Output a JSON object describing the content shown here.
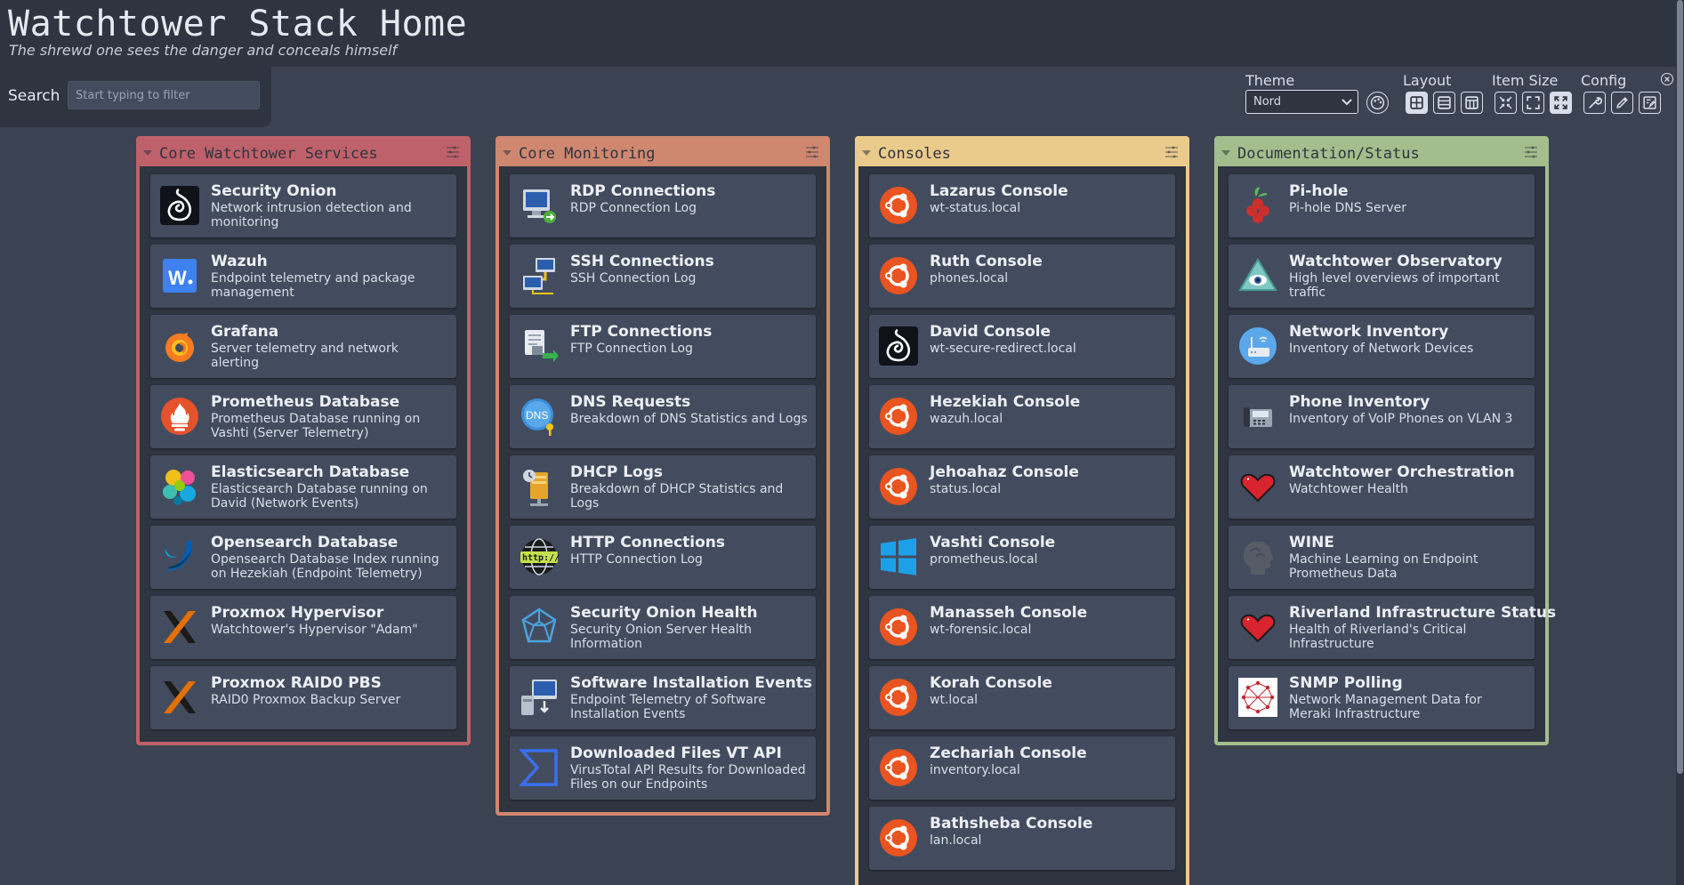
{
  "header": {
    "title": "Watchtower Stack Home",
    "subtitle": "The shrewd one sees the danger and conceals himself"
  },
  "search": {
    "label": "Search",
    "placeholder": "Start typing to filter"
  },
  "settings": {
    "theme_label": "Theme",
    "theme_value": "Nord",
    "layout_label": "Layout",
    "item_size_label": "Item Size",
    "config_label": "Config"
  },
  "colors": {
    "background": "#3b4252",
    "panel": "#2e3440",
    "item": "#434c5e",
    "red": "#bf616a",
    "orange": "#d08770",
    "yellow": "#ebcb8b",
    "green": "#a3be8c"
  },
  "sections": {
    "core": {
      "title": "Core Watchtower Services",
      "items": [
        {
          "name": "Security Onion",
          "desc": "Network intrusion detection and monitoring",
          "icon": "security-onion-icon"
        },
        {
          "name": "Wazuh",
          "desc": "Endpoint telemetry and package management",
          "icon": "wazuh-icon"
        },
        {
          "name": "Grafana",
          "desc": "Server telemetry and network alerting",
          "icon": "grafana-icon"
        },
        {
          "name": "Prometheus Database",
          "desc": "Prometheus Database running on Vashti (Server Telemetry)",
          "icon": "prometheus-icon"
        },
        {
          "name": "Elasticsearch Database",
          "desc": "Elasticsearch Database running on David (Network Events)",
          "icon": "elasticsearch-icon"
        },
        {
          "name": "Opensearch Database",
          "desc": "Opensearch Database Index running on Hezekiah (Endpoint Telemetry)",
          "icon": "opensearch-icon"
        },
        {
          "name": "Proxmox Hypervisor",
          "desc": "Watchtower's Hypervisor \"Adam\"",
          "icon": "proxmox-icon"
        },
        {
          "name": "Proxmox RAID0 PBS",
          "desc": "RAID0 Proxmox Backup Server",
          "icon": "proxmox-icon"
        }
      ]
    },
    "monitoring": {
      "title": "Core Monitoring",
      "items": [
        {
          "name": "RDP Connections",
          "desc": "RDP Connection Log",
          "icon": "rdp-icon"
        },
        {
          "name": "SSH Connections",
          "desc": "SSH Connection Log",
          "icon": "ssh-network-icon"
        },
        {
          "name": "FTP Connections",
          "desc": "FTP Connection Log",
          "icon": "ftp-icon"
        },
        {
          "name": "DNS Requests",
          "desc": "Breakdown of DNS Statistics and Logs",
          "icon": "dns-icon"
        },
        {
          "name": "DHCP Logs",
          "desc": "Breakdown of DHCP Statistics and Logs",
          "icon": "dhcp-icon"
        },
        {
          "name": "HTTP Connections",
          "desc": "HTTP Connection Log",
          "icon": "http-globe-icon"
        },
        {
          "name": "Security Onion Health",
          "desc": "Security Onion Server Health Information",
          "icon": "polyhedron-icon"
        },
        {
          "name": "Software Installation Events",
          "desc": "Endpoint Telemetry of Software Installation Events",
          "icon": "software-install-icon"
        },
        {
          "name": "Downloaded Files VT API",
          "desc": "VirusTotal API Results for Downloaded Files on our Endpoints",
          "icon": "virustotal-icon"
        }
      ]
    },
    "consoles": {
      "title": "Consoles",
      "items": [
        {
          "name": "Lazarus Console",
          "desc": "wt-status.local",
          "icon": "ubuntu-icon"
        },
        {
          "name": "Ruth Console",
          "desc": "phones.local",
          "icon": "ubuntu-icon"
        },
        {
          "name": "David Console",
          "desc": "wt-secure-redirect.local",
          "icon": "security-onion-icon"
        },
        {
          "name": "Hezekiah Console",
          "desc": "wazuh.local",
          "icon": "ubuntu-icon"
        },
        {
          "name": "Jehoahaz Console",
          "desc": "status.local",
          "icon": "ubuntu-icon"
        },
        {
          "name": "Vashti Console",
          "desc": "prometheus.local",
          "icon": "windows-icon"
        },
        {
          "name": "Manasseh Console",
          "desc": "wt-forensic.local",
          "icon": "ubuntu-icon"
        },
        {
          "name": "Korah Console",
          "desc": "wt.local",
          "icon": "ubuntu-icon"
        },
        {
          "name": "Zechariah Console",
          "desc": "inventory.local",
          "icon": "ubuntu-icon"
        },
        {
          "name": "Bathsheba Console",
          "desc": "lan.local",
          "icon": "ubuntu-icon"
        }
      ]
    },
    "docs": {
      "title": "Documentation/Status",
      "items": [
        {
          "name": "Pi-hole",
          "desc": "Pi-hole DNS Server",
          "icon": "pihole-icon"
        },
        {
          "name": "Watchtower Observatory",
          "desc": "High level overviews of important traffic",
          "icon": "eye-pyramid-icon"
        },
        {
          "name": "Network Inventory",
          "desc": "Inventory of Network Devices",
          "icon": "router-icon"
        },
        {
          "name": "Phone Inventory",
          "desc": "Inventory of VoIP Phones on VLAN 3",
          "icon": "voip-phone-icon"
        },
        {
          "name": "Watchtower Orchestration",
          "desc": "Watchtower Health",
          "icon": "heart-icon"
        },
        {
          "name": "WINE",
          "desc": "Machine Learning on Endpoint Prometheus Data",
          "icon": "brain-head-icon"
        },
        {
          "name": "Riverland Infrastructure Status",
          "desc": "Health of Riverland's Critical Infrastructure",
          "icon": "heart-icon"
        },
        {
          "name": "SNMP Polling",
          "desc": "Network Management Data for Meraki Infrastructure",
          "icon": "meraki-icon"
        }
      ]
    }
  }
}
